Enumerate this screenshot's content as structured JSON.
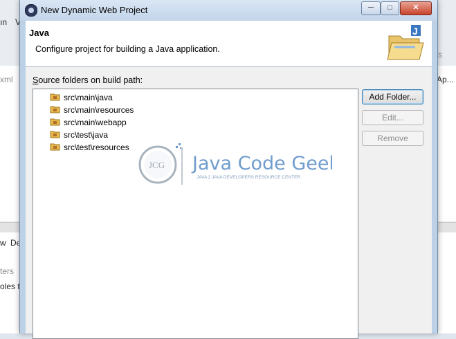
{
  "background": {
    "menu_fragment_1": "ın",
    "menu_fragment_2": "V",
    "left_fragment_xml": "xml",
    "right_fragment_s": "s",
    "right_fragment_ap": "Ap...",
    "tab_fragment_w": "w",
    "tab_fragment_de": "De",
    "left_fragment_ters": "ters",
    "left_fragment_roles": "oles t"
  },
  "dialog": {
    "title": "New Dynamic Web Project",
    "window_buttons": {
      "minimize": "─",
      "maximize": "□",
      "close": "✕"
    },
    "header": {
      "title": "Java",
      "description": "Configure project for building a Java application."
    },
    "source_label_prefix": "S",
    "source_label_rest": "ource folders on build path:",
    "source_folders": [
      "src\\main\\java",
      "src\\main\\resources",
      "src\\main\\webapp",
      "src\\test\\java",
      "src\\test\\resources"
    ],
    "buttons": {
      "add_folder": "Add Folder...",
      "edit": "Edit...",
      "remove": "Remove"
    }
  },
  "watermark": {
    "logo_letters": "JCG",
    "name": "Java Code Geeks",
    "tagline": "JAVA 2 JAVA DEVELOPERS RESOURCE CENTER"
  },
  "colors": {
    "titlebar": "#c3d5ea",
    "dialog_frame": "#bcd0e6",
    "watermark_blue": "#2e6fb6",
    "default_button_border": "#3c7fb1",
    "folder_yellow": "#e7b84a"
  }
}
